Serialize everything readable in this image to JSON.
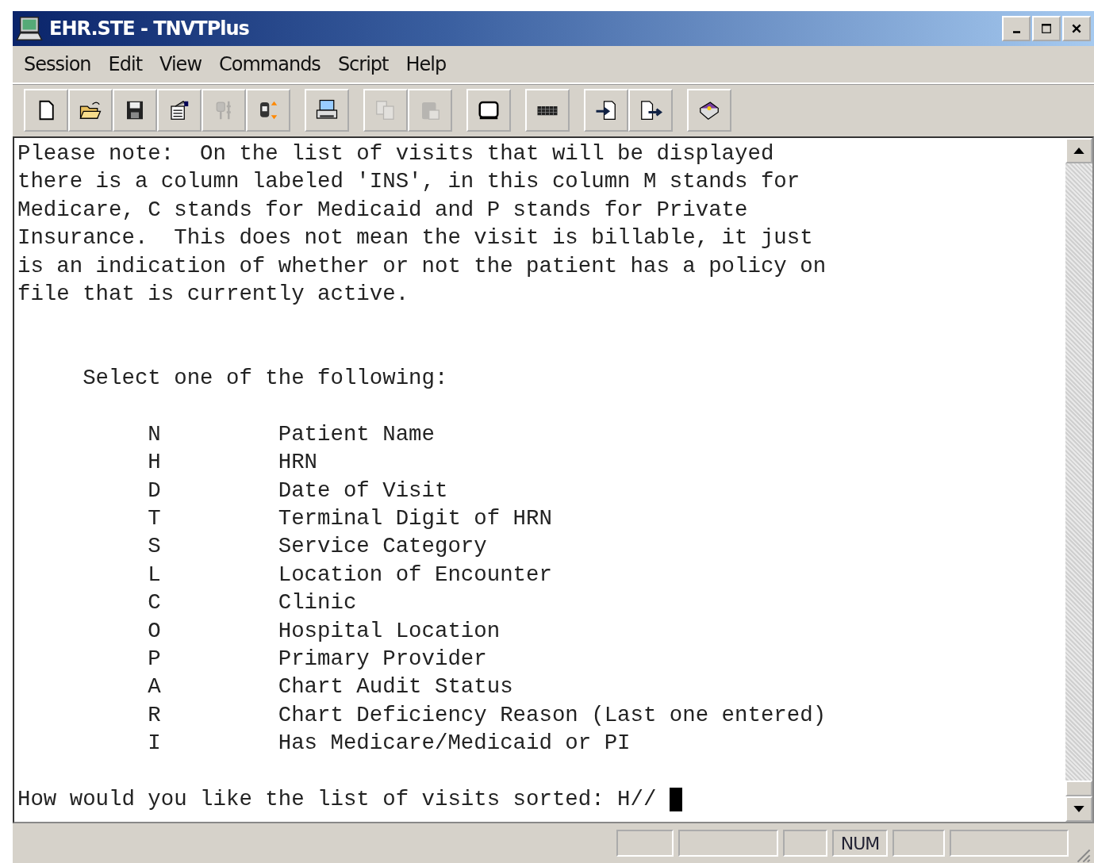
{
  "window": {
    "title": "EHR.STE - TNVTPlus"
  },
  "menu": [
    "Session",
    "Edit",
    "View",
    "Commands",
    "Script",
    "Help"
  ],
  "toolbar": [
    [
      {
        "kind": "new",
        "disabled": false
      },
      {
        "kind": "open",
        "disabled": false
      },
      {
        "kind": "save",
        "disabled": false
      },
      {
        "kind": "properties",
        "disabled": false
      },
      {
        "kind": "connect",
        "disabled": true
      },
      {
        "kind": "transfer",
        "disabled": false
      }
    ],
    [
      {
        "kind": "print",
        "disabled": false
      }
    ],
    [
      {
        "kind": "copy",
        "disabled": true
      },
      {
        "kind": "paste",
        "disabled": true
      }
    ],
    [
      {
        "kind": "screen",
        "disabled": false
      }
    ],
    [
      {
        "kind": "keyboard",
        "disabled": false
      }
    ],
    [
      {
        "kind": "import",
        "disabled": false
      },
      {
        "kind": "export",
        "disabled": false
      }
    ],
    [
      {
        "kind": "help",
        "disabled": false
      }
    ]
  ],
  "terminal": {
    "note_lines": [
      "Please note:  On the list of visits that will be displayed",
      "there is a column labeled 'INS', in this column M stands for",
      "Medicare, C stands for Medicaid and P stands for Private",
      "Insurance.  This does not mean the visit is billable, it just",
      "is an indication of whether or not the patient has a policy on",
      "file that is currently active."
    ],
    "heading": "Select one of the following:",
    "options": [
      {
        "key": "N",
        "label": "Patient Name"
      },
      {
        "key": "H",
        "label": "HRN"
      },
      {
        "key": "D",
        "label": "Date of Visit"
      },
      {
        "key": "T",
        "label": "Terminal Digit of HRN"
      },
      {
        "key": "S",
        "label": "Service Category"
      },
      {
        "key": "L",
        "label": "Location of Encounter"
      },
      {
        "key": "C",
        "label": "Clinic"
      },
      {
        "key": "O",
        "label": "Hospital Location"
      },
      {
        "key": "P",
        "label": "Primary Provider"
      },
      {
        "key": "A",
        "label": "Chart Audit Status"
      },
      {
        "key": "R",
        "label": "Chart Deficiency Reason (Last one entered)"
      },
      {
        "key": "I",
        "label": "Has Medicare/Medicaid or PI"
      }
    ],
    "prompt": "How would you like the list of visits sorted: H//"
  },
  "status_bar": {
    "indicator": "NUM"
  }
}
